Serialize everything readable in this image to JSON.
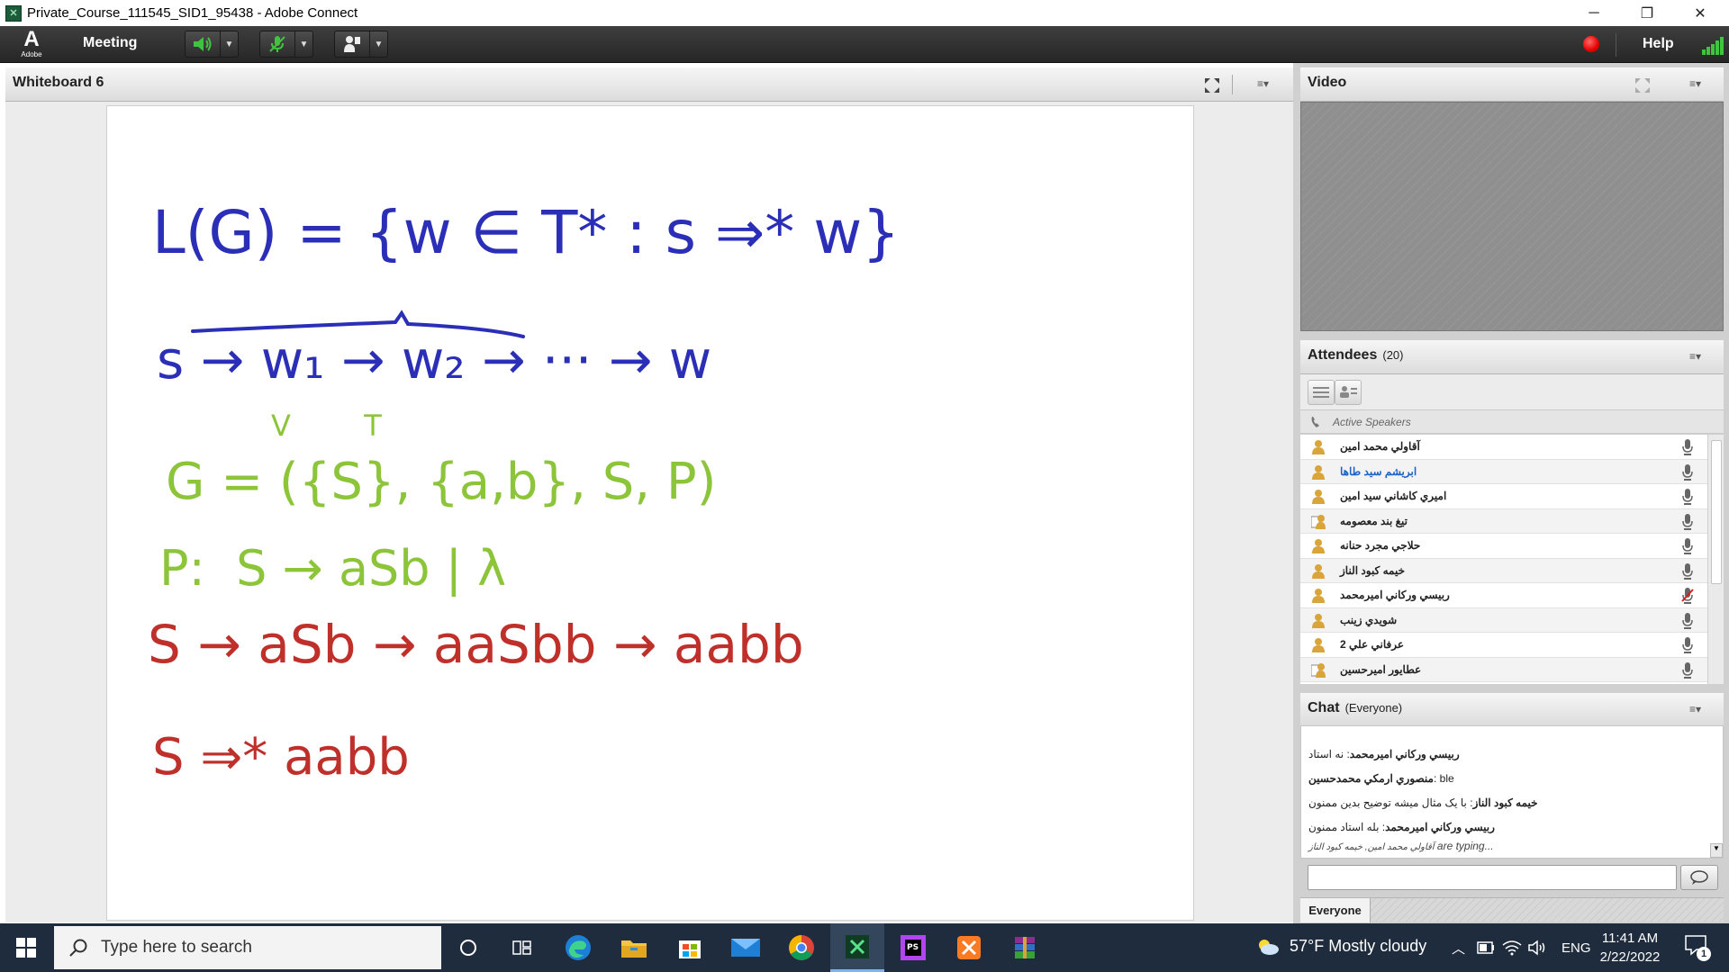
{
  "window": {
    "title": "Private_Course_111545_SID1_95438 - Adobe Connect",
    "minimize": "─",
    "restore": "❐",
    "close": "✕"
  },
  "menubar": {
    "logo_letter": "A",
    "logo_text": "Adobe",
    "meeting_label": "Meeting",
    "help_label": "Help"
  },
  "whiteboard": {
    "title": "Whiteboard 6",
    "lines": [
      {
        "text": "L(G) = {w ∈ T* : s ⇒* w}",
        "color": "#2b2fb8"
      },
      {
        "text": "s → w₁ → w₂ → ··· → w",
        "color": "#2b2fb8"
      },
      {
        "text": "V        T",
        "color": "#8cc43a"
      },
      {
        "text": "G = ({S}, {a,b}, S, P)",
        "color": "#8cc43a"
      },
      {
        "text": "P:  S → aSb | λ",
        "color": "#8cc43a"
      },
      {
        "text": "S → aSb → aaSbb → aabb",
        "color": "#c0302a"
      },
      {
        "text": "S ⇒* aabb",
        "color": "#c0302a"
      }
    ]
  },
  "video": {
    "title": "Video"
  },
  "attendees": {
    "title": "Attendees",
    "count": "(20)",
    "active_speakers_label": "Active Speakers",
    "list": [
      {
        "name": "آقاولي محمد امين",
        "highlight": false,
        "muted": false,
        "host": false
      },
      {
        "name": "ابريشم سيد طاها",
        "highlight": true,
        "muted": false,
        "host": false
      },
      {
        "name": "اميري كاشاني سيد امين",
        "highlight": false,
        "muted": false,
        "host": false
      },
      {
        "name": "تيغ بند معصومه",
        "highlight": false,
        "muted": false,
        "host": true
      },
      {
        "name": "حلاجي مجرد حنانه",
        "highlight": false,
        "muted": false,
        "host": false
      },
      {
        "name": "خيمه كبود الناز",
        "highlight": false,
        "muted": false,
        "host": false
      },
      {
        "name": "ربيسي وركاني اميرمحمد",
        "highlight": false,
        "muted": true,
        "host": false
      },
      {
        "name": "شويدي زينب",
        "highlight": false,
        "muted": false,
        "host": false
      },
      {
        "name": "عرفاني علي 2",
        "highlight": false,
        "muted": false,
        "host": false
      },
      {
        "name": "عطايور اميرحسين",
        "highlight": false,
        "muted": false,
        "host": true
      }
    ]
  },
  "chat": {
    "title": "Chat",
    "scope": "(Everyone)",
    "messages": [
      {
        "sender": "ربيسي وركاني اميرمحمد",
        "text": "نه استاد"
      },
      {
        "sender": "منصوري ارمكي محمدحسين",
        "text": "ble"
      },
      {
        "sender": "خيمه كبود الناز",
        "text": "با یک مثال میشه توضیح بدین ممنون"
      },
      {
        "sender": "ربيسي وركاني اميرمحمد",
        "text": "بله استاد ممنون"
      }
    ],
    "typing_names": "آقاولي محمد امين, خيمه كبود الناز",
    "typing_suffix": "are typing...",
    "input_value": "",
    "tab_label": "Everyone"
  },
  "taskbar": {
    "search_placeholder": "Type here to search",
    "weather": "57°F  Mostly cloudy",
    "language": "ENG",
    "time": "11:41 AM",
    "date": "2/22/2022",
    "notification_count": "1"
  },
  "colors": {
    "menubar": "#2e2e2e",
    "taskbar": "#1f2c3d",
    "record": "#e60000",
    "speaker_green": "#3ec43e",
    "ink_blue": "#2b2fb8",
    "ink_green": "#8cc43a",
    "ink_red": "#c0302a"
  }
}
